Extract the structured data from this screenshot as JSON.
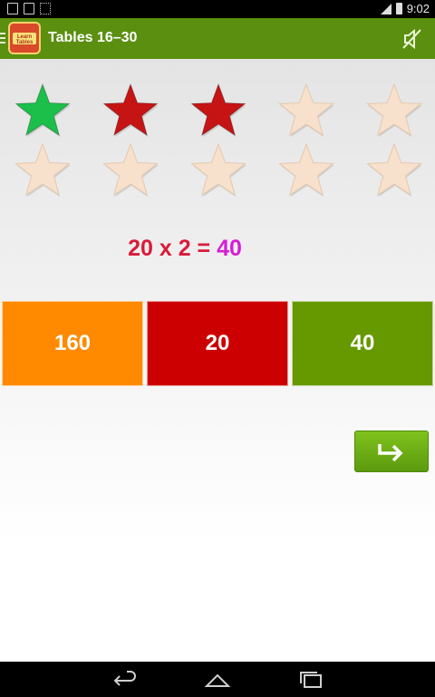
{
  "status_bar": {
    "time": "9:02"
  },
  "action_bar": {
    "title": "Tables 16–30",
    "logo_text": "Learn Tables"
  },
  "stars": [
    {
      "state": "correct",
      "color": "#1bbf4a"
    },
    {
      "state": "wrong",
      "color": "#c61414"
    },
    {
      "state": "wrong",
      "color": "#c61414"
    },
    {
      "state": "empty",
      "color": "#f7e0cc"
    },
    {
      "state": "empty",
      "color": "#f7e0cc"
    },
    {
      "state": "empty",
      "color": "#f7e0cc"
    },
    {
      "state": "empty",
      "color": "#f7e0cc"
    },
    {
      "state": "empty",
      "color": "#f7e0cc"
    },
    {
      "state": "empty",
      "color": "#f7e0cc"
    },
    {
      "state": "empty",
      "color": "#f7e0cc"
    }
  ],
  "question": {
    "expression": "20 x 2 = ",
    "answer": "40"
  },
  "options": [
    {
      "label": "160",
      "color": "#ff8a00"
    },
    {
      "label": "20",
      "color": "#cc0000"
    },
    {
      "label": "40",
      "color": "#669900"
    }
  ],
  "next_button": {
    "icon": "forward-arrow-icon"
  },
  "nav": {
    "back": "back-icon",
    "home": "home-icon",
    "recents": "recents-icon"
  }
}
